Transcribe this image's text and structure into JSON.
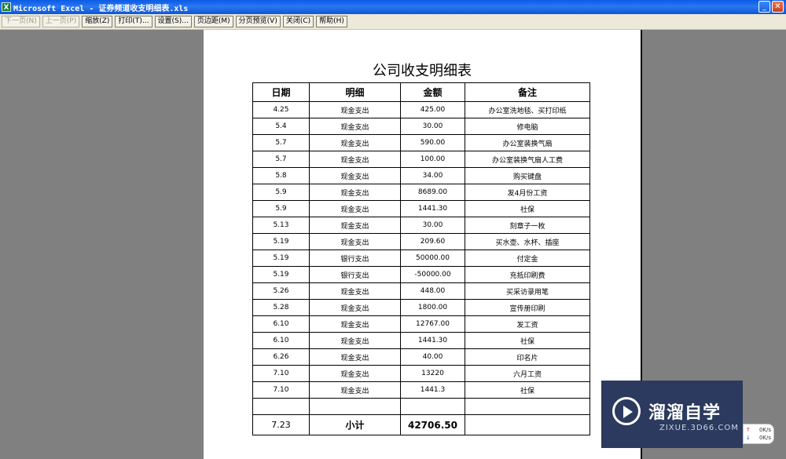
{
  "window": {
    "title": "Microsoft Excel - 证券频道收支明细表.xls",
    "app_icon": "X"
  },
  "toolbar": {
    "next_page": "下一页(N)",
    "prev_page": "上一页(P)",
    "zoom": "缩放(Z)",
    "print": "打印(T)...",
    "setup": "设置(S)...",
    "margins": "页边距(M)",
    "page_break_preview": "分页预览(V)",
    "close": "关闭(C)",
    "help": "帮助(H)"
  },
  "sheet": {
    "title": "公司收支明细表",
    "headers": [
      "日期",
      "明细",
      "金额",
      "备注"
    ],
    "rows": [
      [
        "4.25",
        "现金支出",
        "425.00",
        "办公室洗地毯、买打印纸"
      ],
      [
        "5.4",
        "现金支出",
        "30.00",
        "修电脑"
      ],
      [
        "5.7",
        "现金支出",
        "590.00",
        "办公室装换气扇"
      ],
      [
        "5.7",
        "现金支出",
        "100.00",
        "办公室装换气扇人工费"
      ],
      [
        "5.8",
        "现金支出",
        "34.00",
        "购买键盘"
      ],
      [
        "5.9",
        "现金支出",
        "8689.00",
        "发4月份工资"
      ],
      [
        "5.9",
        "现金支出",
        "1441.30",
        "社保"
      ],
      [
        "5.13",
        "现金支出",
        "30.00",
        "刻章子一枚"
      ],
      [
        "5.19",
        "现金支出",
        "209.60",
        "买水壶、水杯、插座"
      ],
      [
        "5.19",
        "银行支出",
        "50000.00",
        "付定金"
      ],
      [
        "5.19",
        "银行支出",
        "-50000.00",
        "充抵印刷费"
      ],
      [
        "5.26",
        "现金支出",
        "448.00",
        "买采访录用笔"
      ],
      [
        "5.28",
        "现金支出",
        "1800.00",
        "宣传册印刷"
      ],
      [
        "6.10",
        "现金支出",
        "12767.00",
        "发工资"
      ],
      [
        "6.10",
        "现金支出",
        "1441.30",
        "社保"
      ],
      [
        "6.26",
        "现金支出",
        "40.00",
        "印名片"
      ],
      [
        "7.10",
        "现金支出",
        "13220",
        "六月工资"
      ],
      [
        "7.10",
        "现金支出",
        "1441.3",
        "社保"
      ]
    ],
    "total": {
      "date": "7.23",
      "label": "小计",
      "amount": "42706.50",
      "note": ""
    }
  },
  "watermark": {
    "name": "溜溜自学",
    "url": "ZIXUE.3D66.COM"
  },
  "netspeed": {
    "up": "0K/s",
    "down": "0K/s"
  }
}
